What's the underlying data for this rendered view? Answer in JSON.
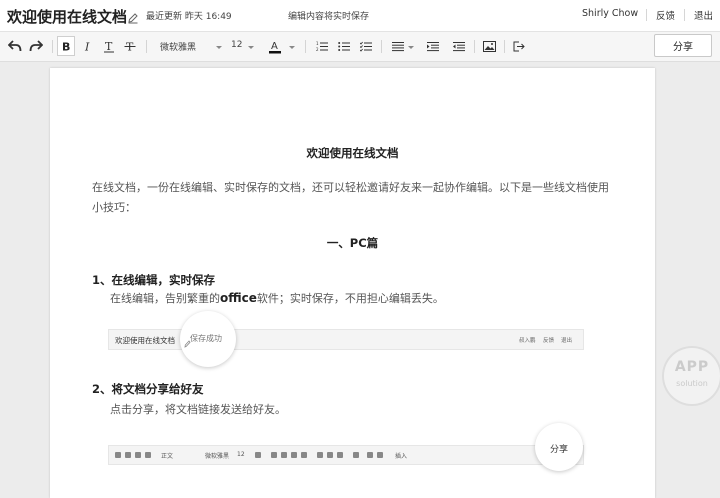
{
  "header": {
    "doc_title": "欢迎使用在线文档",
    "last_update": "最近更新 昨天 16:49",
    "save_note": "编辑内容将实时保存",
    "user_name": "Shirly Chow",
    "feedback": "反馈",
    "logout": "退出"
  },
  "toolbar": {
    "font_family": "微软雅黑",
    "font_size": "12",
    "share_label": "分享",
    "text_color": "#111111"
  },
  "document": {
    "title": "欢迎使用在线文档",
    "intro": "在线文档，一份在线编辑、实时保存的文档，还可以轻松邀请好友来一起协作编辑。以下是一些线文档使用小技巧：",
    "section_pc": "一、PC篇",
    "item1_heading": "1、在线编辑，实时保存",
    "item1_text_a": "在线编辑，告别繁重的",
    "item1_text_b": "office",
    "item1_text_c": "软件；实时保存，不用担心编辑丢失。",
    "item2_heading": "2、将文档分享给好友",
    "item2_text": "点击分享，将文档链接发送给好友。"
  },
  "screenshot1": {
    "title": "欢迎使用在线文档",
    "bubble_text": "保存成功",
    "right_user": "叔入鹏",
    "right_feedback": "反馈",
    "right_logout": "退出"
  },
  "screenshot2": {
    "style_label": "正文",
    "font_label": "微软雅黑",
    "size_label": "12",
    "insert_label": "插入",
    "share_label": "分享",
    "avatar_colors": [
      "#c98a6a",
      "#7aa0c0",
      "#b7b07a"
    ]
  },
  "watermark": {
    "line1": "APP",
    "line2": "solution"
  }
}
